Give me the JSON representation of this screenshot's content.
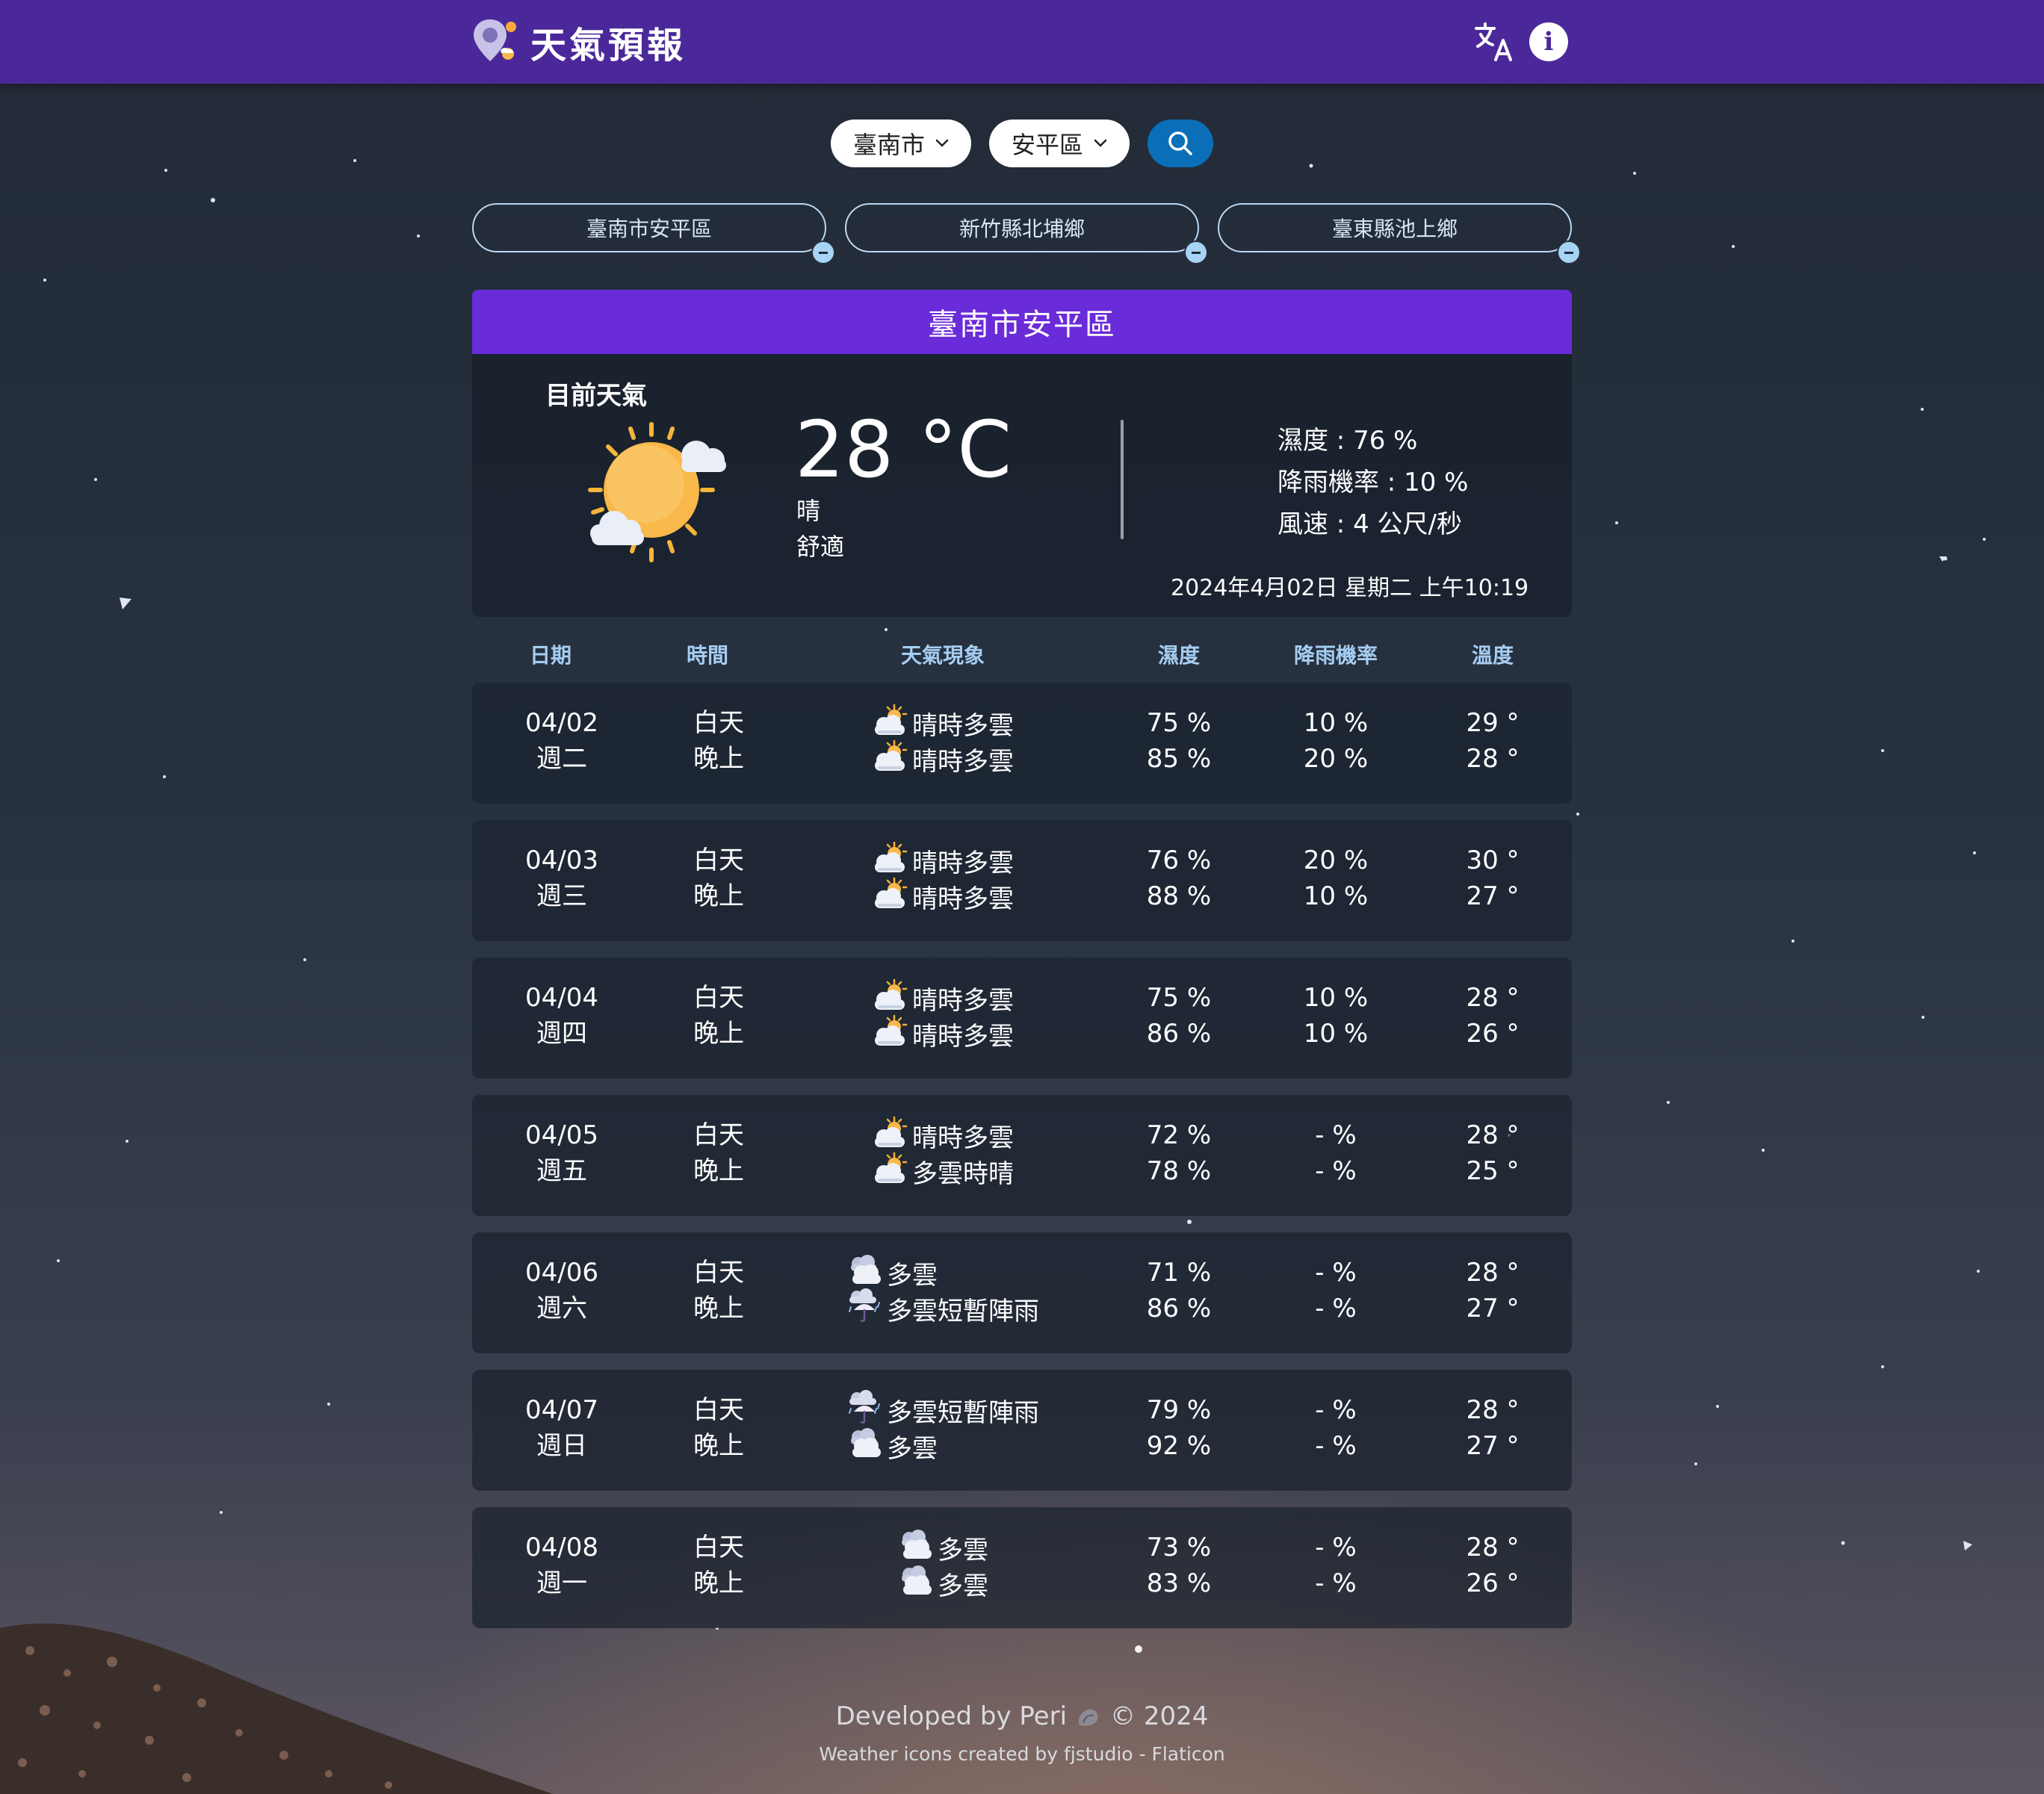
{
  "app": {
    "title": "天氣預報"
  },
  "search": {
    "city": "臺南市",
    "district": "安平區"
  },
  "favorites": [
    "臺南市安平區",
    "新竹縣北埔鄉",
    "臺東縣池上鄉"
  ],
  "location": "臺南市安平區",
  "current": {
    "label": "目前天氣",
    "temperature": "28 °C",
    "condition": "晴",
    "comfort": "舒適",
    "humidity": "濕度 : 76 %",
    "rain_chance": "降雨機率 : 10 %",
    "wind": "風速 : 4 公尺/秒",
    "datetime": "2024年4月02日 星期二 上午10:19",
    "icon": "sunny-partly-cloudy-icon"
  },
  "table": {
    "headers": [
      "日期",
      "時間",
      "天氣現象",
      "濕度",
      "降雨機率",
      "溫度"
    ],
    "rows": [
      {
        "date": "04/02",
        "weekday": "週二",
        "day_label": "白天",
        "night_label": "晚上",
        "day_wx": "晴時多雲",
        "night_wx": "晴時多雲",
        "day_icon": "partly-sunny-icon",
        "night_icon": "partly-sunny-icon",
        "day_hum": "75 %",
        "night_hum": "85 %",
        "day_rain": "10 %",
        "night_rain": "20 %",
        "day_temp": "29 °",
        "night_temp": "28 °"
      },
      {
        "date": "04/03",
        "weekday": "週三",
        "day_label": "白天",
        "night_label": "晚上",
        "day_wx": "晴時多雲",
        "night_wx": "晴時多雲",
        "day_icon": "partly-sunny-icon",
        "night_icon": "partly-sunny-icon",
        "day_hum": "76 %",
        "night_hum": "88 %",
        "day_rain": "20 %",
        "night_rain": "10 %",
        "day_temp": "30 °",
        "night_temp": "27 °"
      },
      {
        "date": "04/04",
        "weekday": "週四",
        "day_label": "白天",
        "night_label": "晚上",
        "day_wx": "晴時多雲",
        "night_wx": "晴時多雲",
        "day_icon": "partly-sunny-icon",
        "night_icon": "partly-sunny-icon",
        "day_hum": "75 %",
        "night_hum": "86 %",
        "day_rain": "10 %",
        "night_rain": "10 %",
        "day_temp": "28 °",
        "night_temp": "26 °"
      },
      {
        "date": "04/05",
        "weekday": "週五",
        "day_label": "白天",
        "night_label": "晚上",
        "day_wx": "晴時多雲",
        "night_wx": "多雲時晴",
        "day_icon": "partly-sunny-icon",
        "night_icon": "partly-sunny-icon",
        "day_hum": "72 %",
        "night_hum": "78 %",
        "day_rain": "- %",
        "night_rain": "- %",
        "day_temp": "28 °",
        "night_temp": "25 °"
      },
      {
        "date": "04/06",
        "weekday": "週六",
        "day_label": "白天",
        "night_label": "晚上",
        "day_wx": "多雲",
        "night_wx": "多雲短暫陣雨",
        "day_icon": "cloudy-icon",
        "night_icon": "rain-umbrella-icon",
        "day_hum": "71 %",
        "night_hum": "86 %",
        "day_rain": "- %",
        "night_rain": "- %",
        "day_temp": "28 °",
        "night_temp": "27 °"
      },
      {
        "date": "04/07",
        "weekday": "週日",
        "day_label": "白天",
        "night_label": "晚上",
        "day_wx": "多雲短暫陣雨",
        "night_wx": "多雲",
        "day_icon": "rain-umbrella-icon",
        "night_icon": "cloudy-icon",
        "day_hum": "79 %",
        "night_hum": "92 %",
        "day_rain": "- %",
        "night_rain": "- %",
        "day_temp": "28 °",
        "night_temp": "27 °"
      },
      {
        "date": "04/08",
        "weekday": "週一",
        "day_label": "白天",
        "night_label": "晚上",
        "day_wx": "多雲",
        "night_wx": "多雲",
        "day_icon": "cloudy-icon",
        "night_icon": "cloudy-icon",
        "day_hum": "73 %",
        "night_hum": "83 %",
        "day_rain": "- %",
        "night_rain": "- %",
        "day_temp": "28 °",
        "night_temp": "26 °"
      }
    ]
  },
  "footer": {
    "credit": "Developed by Peri",
    "copyright": "© 2024",
    "attribution": "Weather icons created by fjstudio - Flaticon"
  },
  "colors": {
    "header_bg": "#4b2899",
    "city_banner": "#6a2bd9",
    "search_button": "#0a6fb8",
    "accent_text": "#a6cdf2"
  }
}
